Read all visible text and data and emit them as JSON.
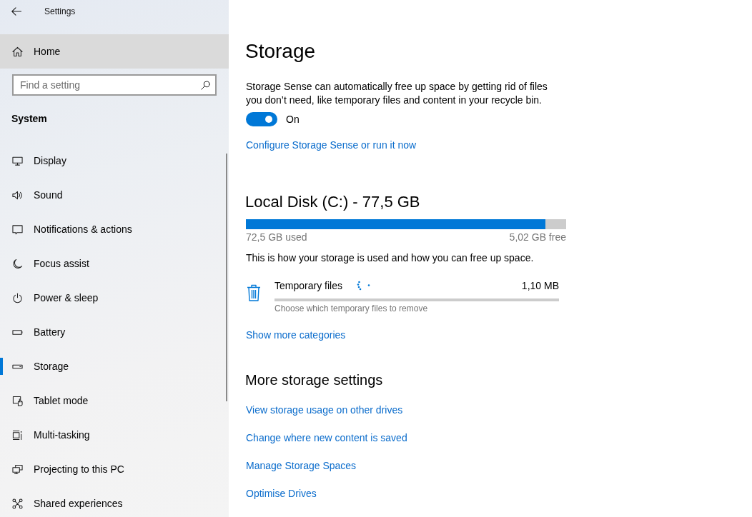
{
  "window": {
    "title": "Settings"
  },
  "sidebar": {
    "home": {
      "label": "Home",
      "hovered": true
    },
    "search": {
      "placeholder": "Find a setting"
    },
    "section": "System",
    "items": [
      {
        "label": "Display",
        "selected": false
      },
      {
        "label": "Sound",
        "selected": false
      },
      {
        "label": "Notifications & actions",
        "selected": false
      },
      {
        "label": "Focus assist",
        "selected": false
      },
      {
        "label": "Power & sleep",
        "selected": false
      },
      {
        "label": "Battery",
        "selected": false
      },
      {
        "label": "Storage",
        "selected": true
      },
      {
        "label": "Tablet mode",
        "selected": false
      },
      {
        "label": "Multi-tasking",
        "selected": false
      },
      {
        "label": "Projecting to this PC",
        "selected": false
      },
      {
        "label": "Shared experiences",
        "selected": false
      }
    ]
  },
  "main": {
    "title": "Storage",
    "storage_sense": {
      "description": "Storage Sense can automatically free up space by getting rid of files you don’t need, like temporary files and content in your recycle bin.",
      "toggle": {
        "on": true,
        "label": "On"
      },
      "link": "Configure Storage Sense or run it now"
    },
    "disk": {
      "title": "Local Disk (C:) - 77,5 GB",
      "level": 0.935,
      "used": "72,5 GB used",
      "free": "5,02 GB free",
      "description": "This is how your storage is used and how you can free up space.",
      "categories": [
        {
          "name": "Temporary files",
          "size": "1,10 MB",
          "hint": "Choose which temporary files to remove",
          "loading": true
        }
      ],
      "more_link": "Show more categories"
    },
    "more_settings": {
      "title": "More storage settings",
      "links": [
        "View storage usage on other drives",
        "Change where new content is saved",
        "Manage Storage Spaces",
        "Optimise Drives"
      ]
    }
  }
}
